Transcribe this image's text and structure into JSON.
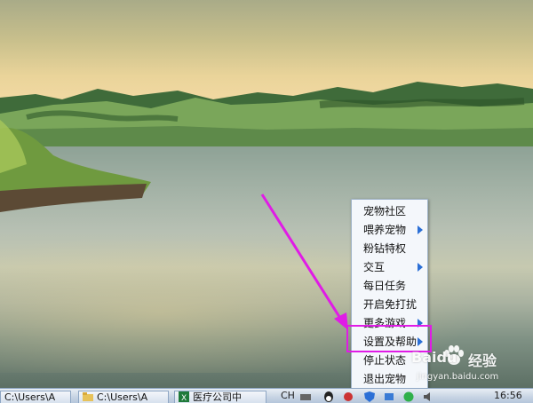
{
  "context_menu": {
    "items": [
      {
        "label": "宠物社区",
        "has_submenu": false
      },
      {
        "label": "喂养宠物",
        "has_submenu": true
      },
      {
        "label": "粉钻特权",
        "has_submenu": false
      },
      {
        "label": "交互",
        "has_submenu": true
      },
      {
        "label": "每日任务",
        "has_submenu": false
      },
      {
        "label": "开启免打扰",
        "has_submenu": false
      },
      {
        "label": "更多游戏",
        "has_submenu": true
      },
      {
        "label": "设置及帮助",
        "has_submenu": true,
        "highlighted": true
      },
      {
        "label": "停止状态",
        "has_submenu": false
      },
      {
        "label": "退出宠物",
        "has_submenu": false
      }
    ]
  },
  "annotation": {
    "color": "#e01be6"
  },
  "taskbar": {
    "buttons": [
      {
        "label": "C:\\Users\\A"
      },
      {
        "label": "C:\\Users\\A"
      },
      {
        "label": "医疗公司中"
      }
    ],
    "language": "CH",
    "clock": "16:56"
  },
  "watermark": {
    "brand": "Baidu",
    "suffix": "经验",
    "url": "jingyan.baidu.com"
  }
}
